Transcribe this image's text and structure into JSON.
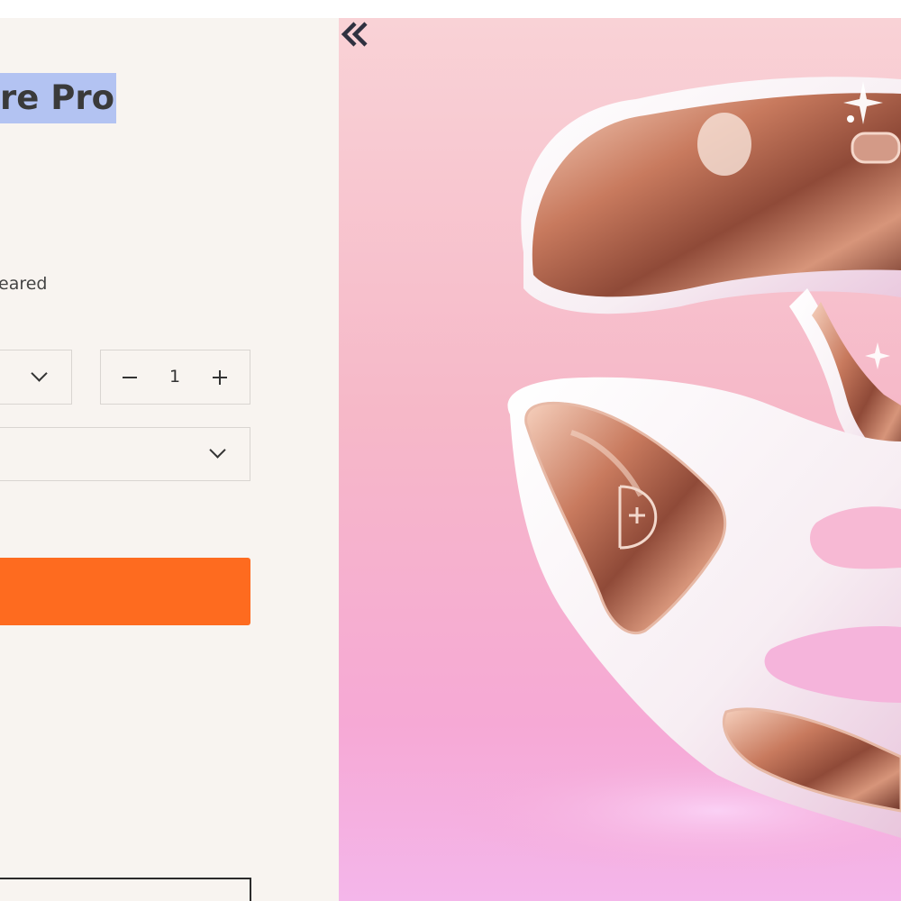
{
  "product": {
    "title_visible": "re Pro",
    "review_text": "eared"
  },
  "variant_select": {
    "value": ""
  },
  "quantity": {
    "value": "1"
  },
  "option_select": {
    "value": ""
  },
  "colors": {
    "accent": "#fe6b1f",
    "selection": "#b3c3f2",
    "background": "#f8f4f0"
  },
  "icons": {
    "variant_chevron": "chevron-down-icon",
    "option_chevron": "chevron-down-icon",
    "minus": "minus-icon",
    "plus": "plus-icon",
    "gallery_prev": "double-chevron-left-icon",
    "brand_mark": "brand-logo"
  }
}
